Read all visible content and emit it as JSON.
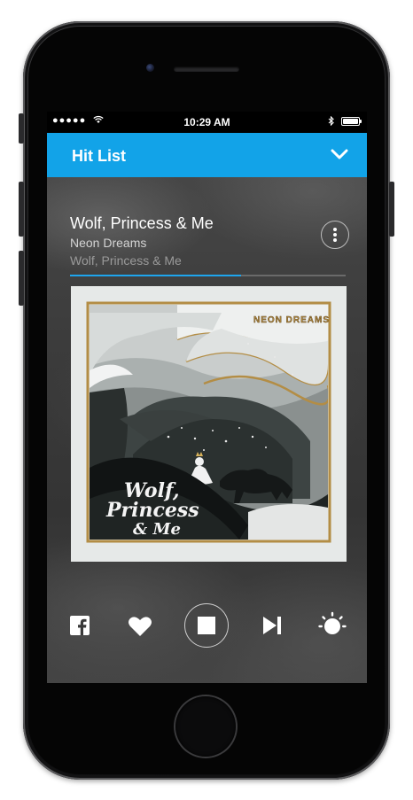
{
  "status_bar": {
    "signal": "●●●●●",
    "time": "10:29 AM"
  },
  "header": {
    "title": "Hit List"
  },
  "now_playing": {
    "title": "Wolf, Princess & Me",
    "artist": "Neon Dreams",
    "album": "Wolf, Princess & Me",
    "progress_percent": 62
  },
  "album_art": {
    "band_logo": "NEON DREAMS",
    "cover_title_line1": "Wolf,",
    "cover_title_line2": "Princess",
    "cover_title_line3": "& Me"
  },
  "controls": {
    "share_icon": "facebook-icon",
    "like_icon": "heart-icon",
    "stop_icon": "stop-icon",
    "skip_icon": "skip-next-icon",
    "extra_icon": "sun-icon"
  },
  "colors": {
    "accent": "#12a3e8",
    "progress": "#1ea5ee"
  }
}
